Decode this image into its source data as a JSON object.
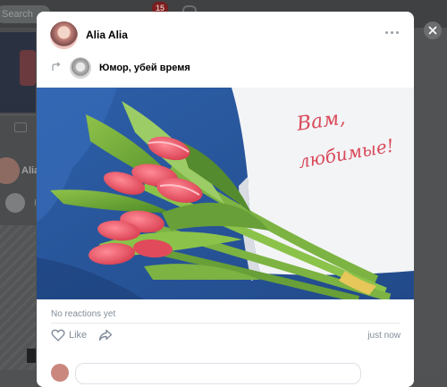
{
  "background": {
    "search_placeholder": "Search",
    "notifications_count": "15",
    "feed_author_name": "Alia",
    "feed_letter": "I"
  },
  "modal": {
    "author_name": "Alia Alia",
    "repost_icon": "repost-arrow-icon",
    "group_name": "Юмор, убей время",
    "image": {
      "description_text_line1": "Вам,",
      "description_text_line2": "любимые!"
    },
    "reactions_text": "No reactions yet",
    "like_label": "Like",
    "time": "just now"
  },
  "colors": {
    "link_gray": "#818c99",
    "overlay": "#505253",
    "accent_red": "#d94a5a"
  }
}
